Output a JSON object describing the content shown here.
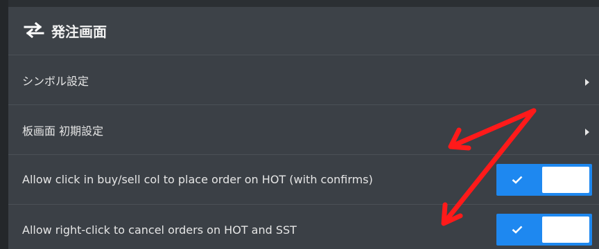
{
  "header": {
    "icon": "swap-arrows-icon",
    "title": "発注画面"
  },
  "rows": [
    {
      "label": "シンボル設定",
      "type": "submenu",
      "icon": "chevron-right-icon"
    },
    {
      "label": "板画面 初期設定",
      "type": "submenu",
      "icon": "chevron-right-icon"
    },
    {
      "label": "Allow click in buy/sell col to place order on HOT (with confirms)",
      "type": "toggle",
      "checked": true
    },
    {
      "label": "Allow right-click to cancel orders on HOT and SST",
      "type": "toggle",
      "checked": true
    }
  ],
  "colors": {
    "panel": "#3b4046",
    "toggle_on": "#1e88f0",
    "annotation_arrow": "#ff1a1a"
  }
}
